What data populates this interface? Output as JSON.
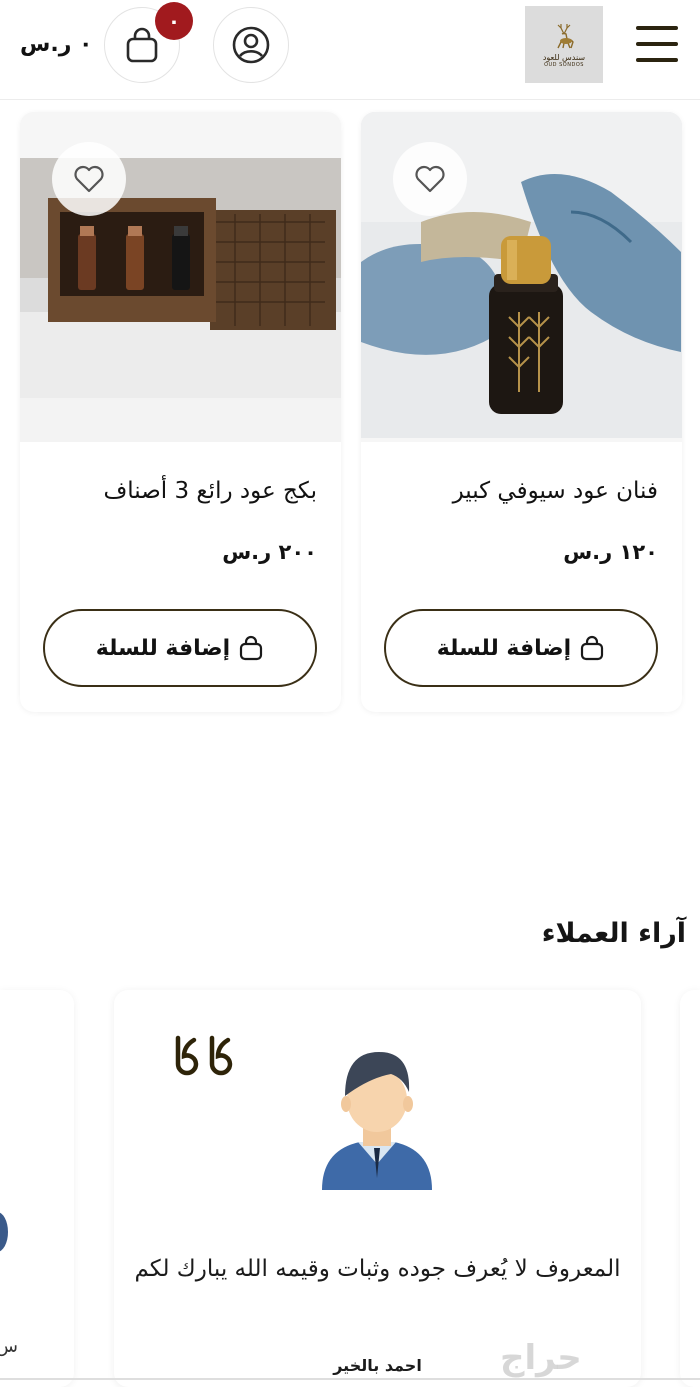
{
  "header": {
    "cart_total": "٠ ر.س",
    "cart_count": "٠",
    "logo": {
      "arabic": "سندس للعود",
      "english": "OUD SONDOS"
    }
  },
  "products": [
    {
      "name": "فنان عود سيوفي كبير",
      "price": "١٢٠ ر.س",
      "add_label": "إضافة للسلة"
    },
    {
      "name": "بكج عود رائع 3 أصناف",
      "price": "٢٠٠ ر.س",
      "add_label": "إضافة للسلة"
    }
  ],
  "reviews": {
    "title": "آراء العملاء",
    "items": [
      {
        "text": "المعروف لا يُعرف جوده وثبات وقيمه الله يبارك لكم",
        "author": "احمد بالخير"
      }
    ],
    "peek_fragment": "س"
  },
  "watermark": "حراج",
  "colors": {
    "badge": "#a11a1e",
    "brand_dark": "#3a2f16",
    "quote": "#2e2409"
  }
}
